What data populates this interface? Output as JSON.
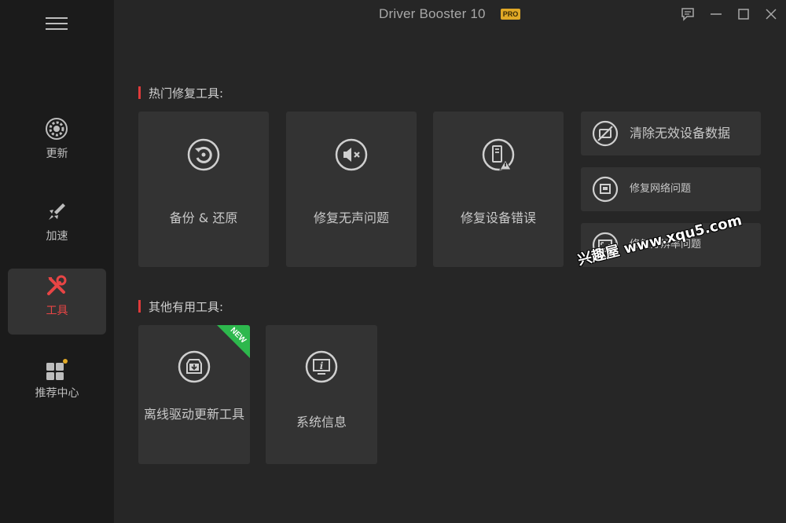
{
  "app": {
    "title": "Driver Booster 10",
    "badge": "PRO"
  },
  "sidebar": {
    "items": [
      {
        "label": "更新",
        "icon": "gear-icon"
      },
      {
        "label": "加速",
        "icon": "rocket-icon"
      },
      {
        "label": "工具",
        "icon": "tools-icon",
        "active": true
      },
      {
        "label": "推荐中心",
        "icon": "apps-grid-icon"
      }
    ]
  },
  "sections": {
    "hot_title": "热门修复工具:",
    "other_title": "其他有用工具:"
  },
  "hot_tools": [
    {
      "label": "备份 & 还原",
      "icon": "backup-restore-icon"
    },
    {
      "label": "修复无声问题",
      "icon": "speaker-mute-icon"
    },
    {
      "label": "修复设备错误",
      "icon": "device-error-icon"
    }
  ],
  "side_tools": [
    {
      "label": "清除无效设备数据",
      "icon": "clean-device-icon"
    },
    {
      "label": "修复网络问题",
      "icon": "network-icon"
    },
    {
      "label": "修复分辨率问题",
      "icon": "resolution-icon"
    }
  ],
  "other_tools": [
    {
      "label": "离线驱动更新工具",
      "icon": "offline-update-icon",
      "badge": "NEW"
    },
    {
      "label": "系统信息",
      "icon": "system-info-icon"
    }
  ],
  "watermark": "兴趣屋 www.xqu5.com",
  "colors": {
    "accent": "#e03a3a",
    "badge": "#e0a826",
    "new": "#2db84d"
  }
}
